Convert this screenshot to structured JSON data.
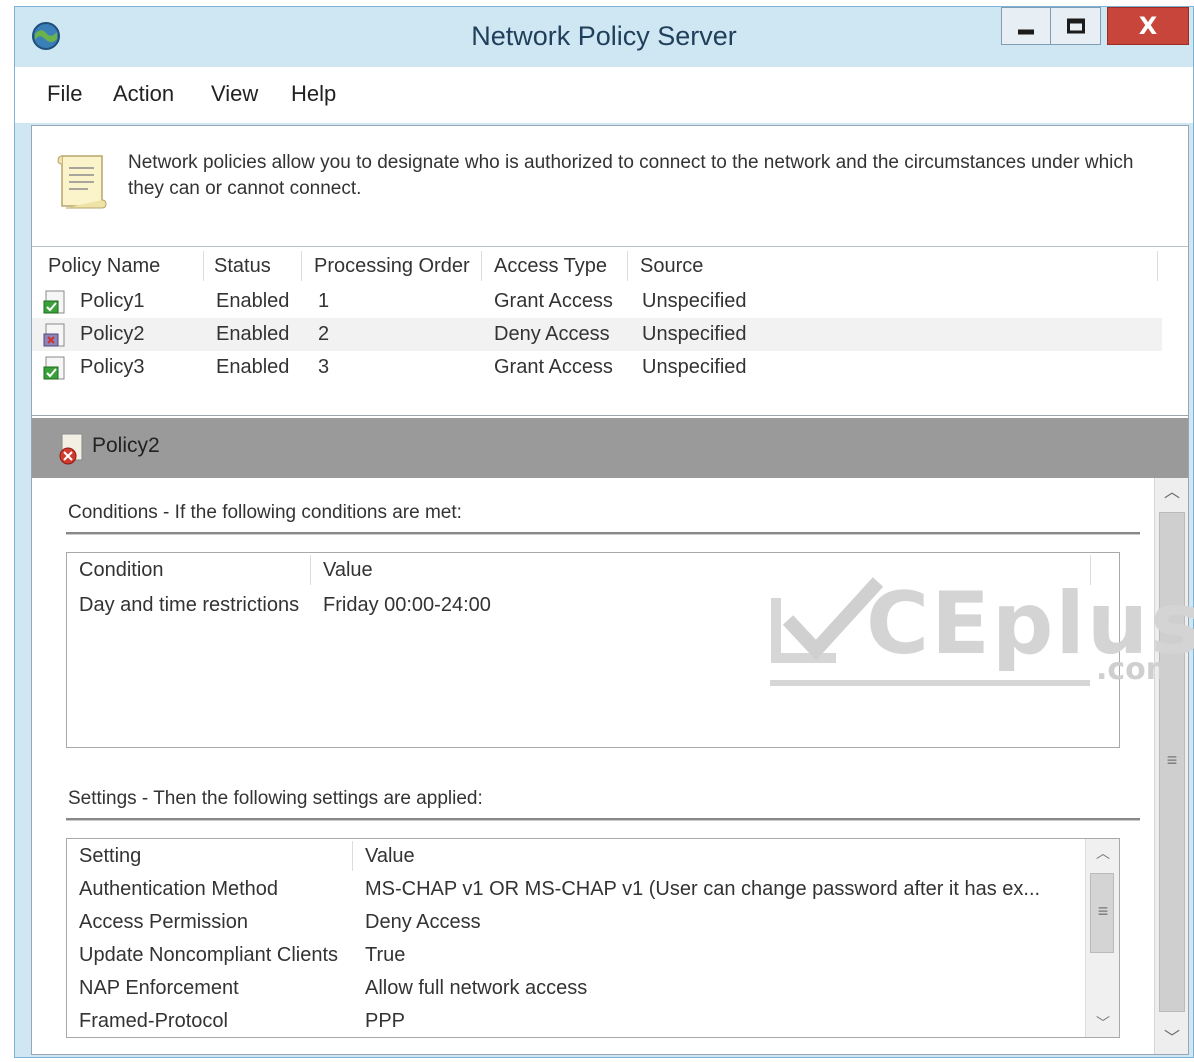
{
  "window": {
    "title": "Network Policy Server"
  },
  "window_controls": {
    "minimize": "minimize",
    "maximize": "maximize",
    "close": "X"
  },
  "menu": [
    "File",
    "Action",
    "View",
    "Help"
  ],
  "description": "Network policies allow you to designate who is authorized to connect to the network and the circumstances under which they can or cannot connect.",
  "policy_list": {
    "columns": [
      "Policy Name",
      "Status",
      "Processing Order",
      "Access Type",
      "Source"
    ],
    "rows": [
      {
        "name": "Policy1",
        "status": "Enabled",
        "order": "1",
        "access": "Grant Access",
        "source": "Unspecified",
        "icon": "grant-policy-icon"
      },
      {
        "name": "Policy2",
        "status": "Enabled",
        "order": "2",
        "access": "Deny Access",
        "source": "Unspecified",
        "icon": "deny-policy-icon"
      },
      {
        "name": "Policy3",
        "status": "Enabled",
        "order": "3",
        "access": "Grant Access",
        "source": "Unspecified",
        "icon": "grant-policy-icon"
      }
    ]
  },
  "detail": {
    "title": "Policy2",
    "conditions_label": "Conditions - If the following conditions are met:",
    "conditions_columns": [
      "Condition",
      "Value"
    ],
    "conditions": [
      {
        "condition": "Day and time restrictions",
        "value": "Friday 00:00-24:00"
      }
    ],
    "settings_label": "Settings - Then the following settings are applied:",
    "settings_columns": [
      "Setting",
      "Value"
    ],
    "settings": [
      {
        "setting": "Authentication Method",
        "value": "MS-CHAP v1 OR MS-CHAP v1 (User can change password after it has ex..."
      },
      {
        "setting": "Access Permission",
        "value": "Deny Access"
      },
      {
        "setting": "Update Noncompliant Clients",
        "value": "True"
      },
      {
        "setting": "NAP Enforcement",
        "value": "Allow full network access"
      },
      {
        "setting": "Framed-Protocol",
        "value": "PPP"
      }
    ]
  },
  "watermark": {
    "text": "CEplus",
    "suffix": ".com"
  },
  "colors": {
    "titlebar": "#cfe6f3",
    "close_button": "#c7453b",
    "detail_header": "#9a9a9a"
  }
}
